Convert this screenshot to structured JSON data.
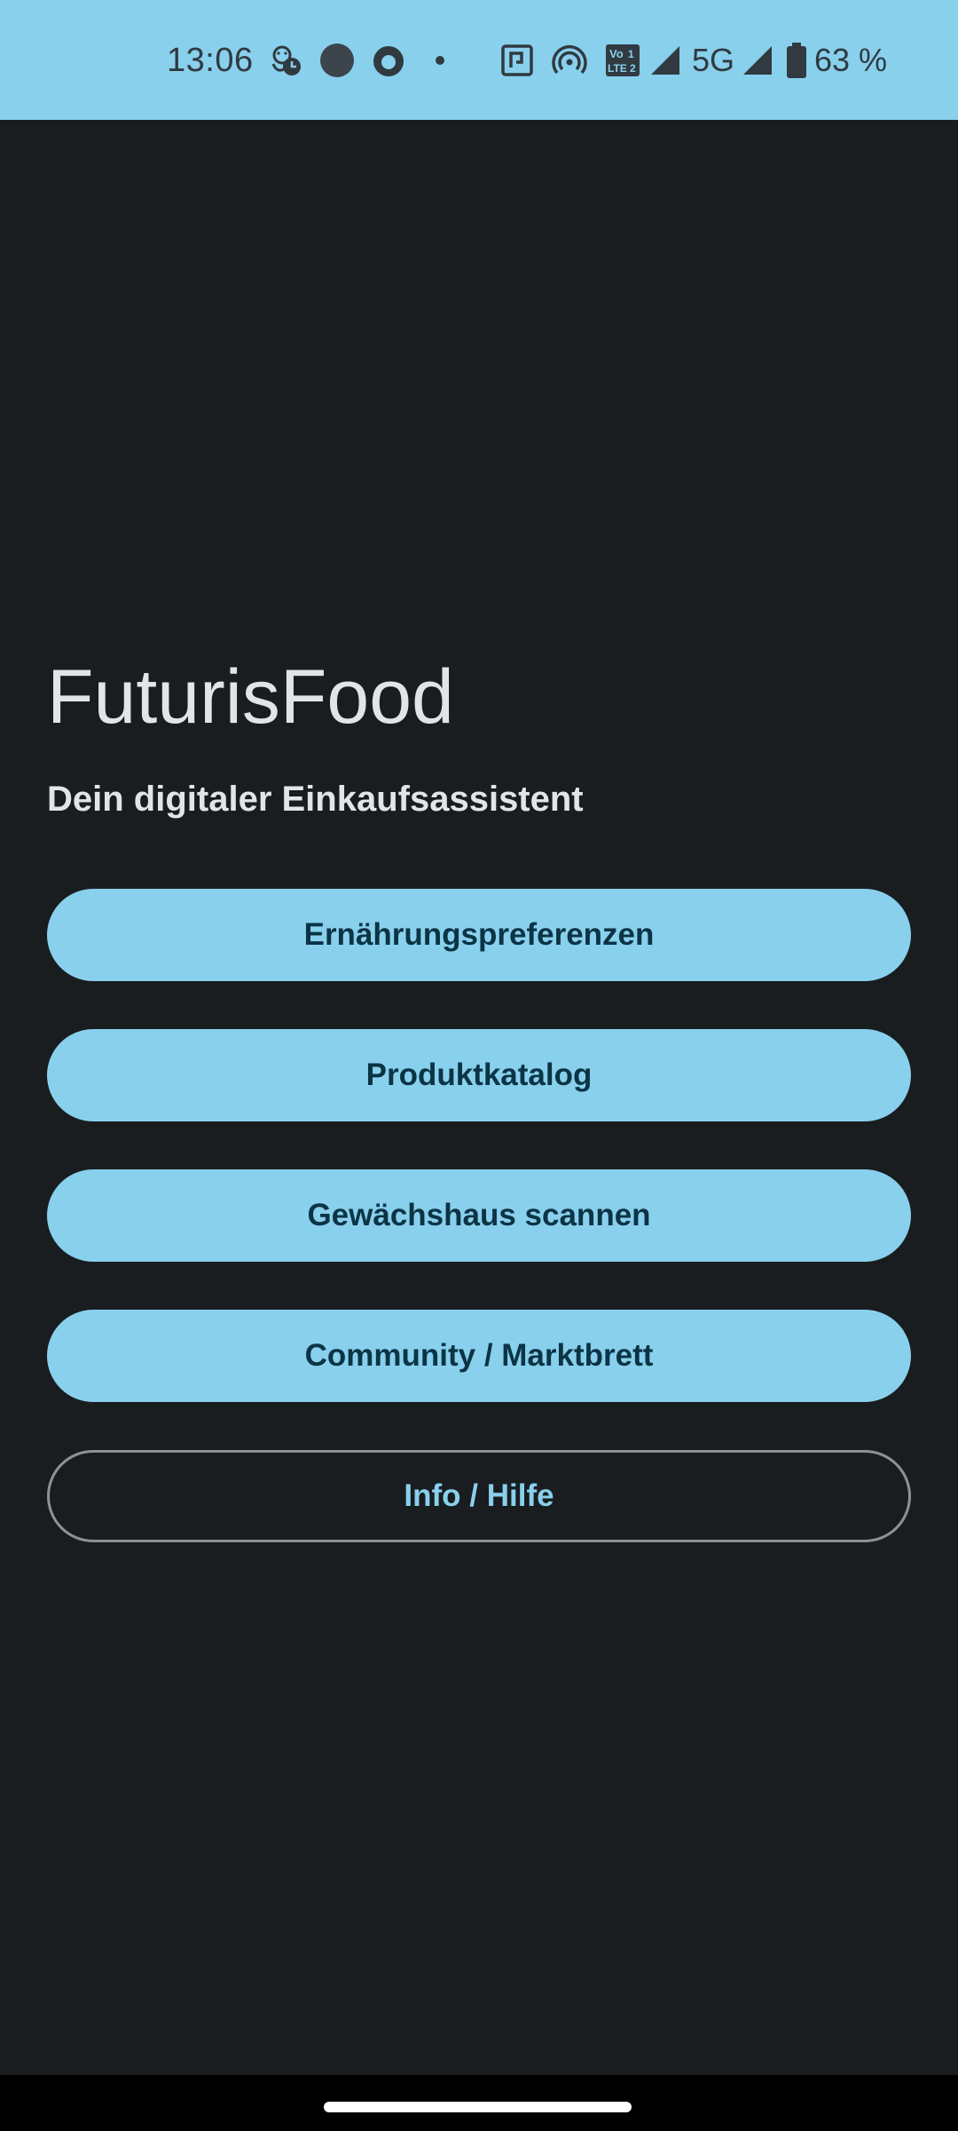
{
  "status_bar": {
    "time": "13:06",
    "network_label": "5G",
    "battery_percent": "63 %",
    "icons": [
      "kid-clock-icon",
      "circle-icon",
      "firefox-icon",
      "dot-icon",
      "nfc-icon",
      "hotspot-icon",
      "volte-icon",
      "signal-icon",
      "signal-icon",
      "battery-icon"
    ],
    "volte_text": {
      "top": "Vo",
      "bottom": "LTE",
      "sim1": "1",
      "sim2": "2"
    },
    "background_color": "#89d0ed"
  },
  "app": {
    "title": "FuturisFood",
    "subtitle": "Dein digitaler Einkaufsassistent"
  },
  "menu": {
    "buttons": [
      {
        "label": "Ernährungspreferenzen",
        "style": "filled"
      },
      {
        "label": "Produktkatalog",
        "style": "filled"
      },
      {
        "label": "Gewächshaus scannen",
        "style": "filled"
      },
      {
        "label": "Community / Marktbrett",
        "style": "filled"
      },
      {
        "label": "Info / Hilfe",
        "style": "outlined"
      }
    ]
  },
  "colors": {
    "background": "#191d20",
    "accent": "#89d0ed",
    "button_text": "#0b3445",
    "title_text": "#e2e4e6",
    "outline_border": "#8c9296"
  }
}
